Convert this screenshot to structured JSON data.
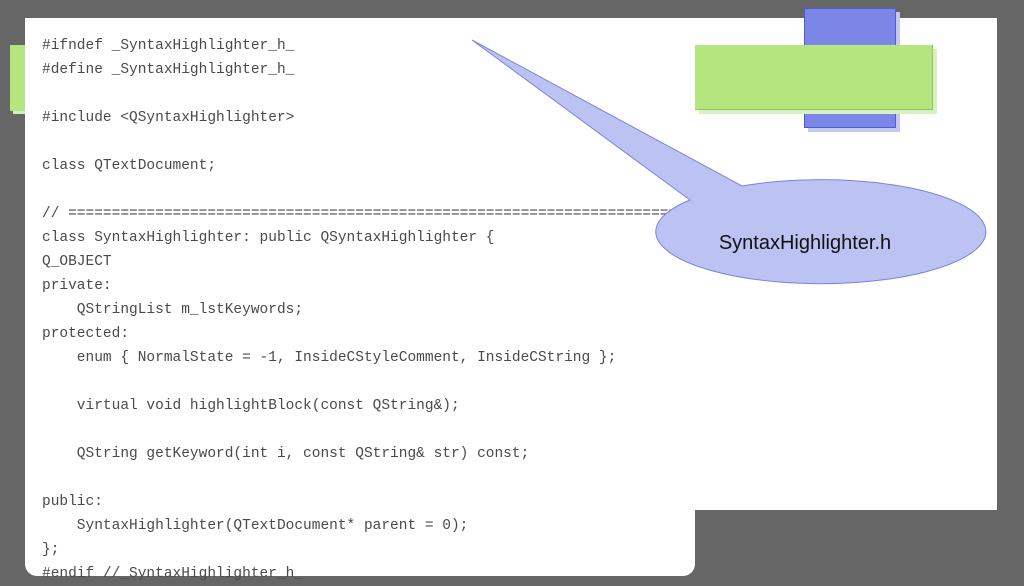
{
  "code_lines": [
    "#ifndef _SyntaxHighlighter_h_",
    "#define _SyntaxHighlighter_h_",
    "",
    "#include <QSyntaxHighlighter>",
    "",
    "class QTextDocument;",
    "",
    "// =========================================================================",
    "class SyntaxHighlighter: public QSyntaxHighlighter {",
    "Q_OBJECT",
    "private:",
    "    QStringList m_lstKeywords;",
    "protected:",
    "    enum { NormalState = -1, InsideCStyleComment, InsideCString };",
    "",
    "    virtual void highlightBlock(const QString&);",
    "",
    "    QString getKeyword(int i, const QString& str) const;",
    "",
    "public:",
    "    SyntaxHighlighter(QTextDocument* parent = 0);",
    "};",
    "#endif //_SyntaxHighlighter_h_"
  ],
  "callout": {
    "label": "SyntaxHighlighter.h"
  },
  "colors": {
    "background": "#666666",
    "callout_fill": "#bcc3f2",
    "callout_stroke": "#7a84d8",
    "green": "#b5e57f",
    "blue": "#7b86e6"
  }
}
